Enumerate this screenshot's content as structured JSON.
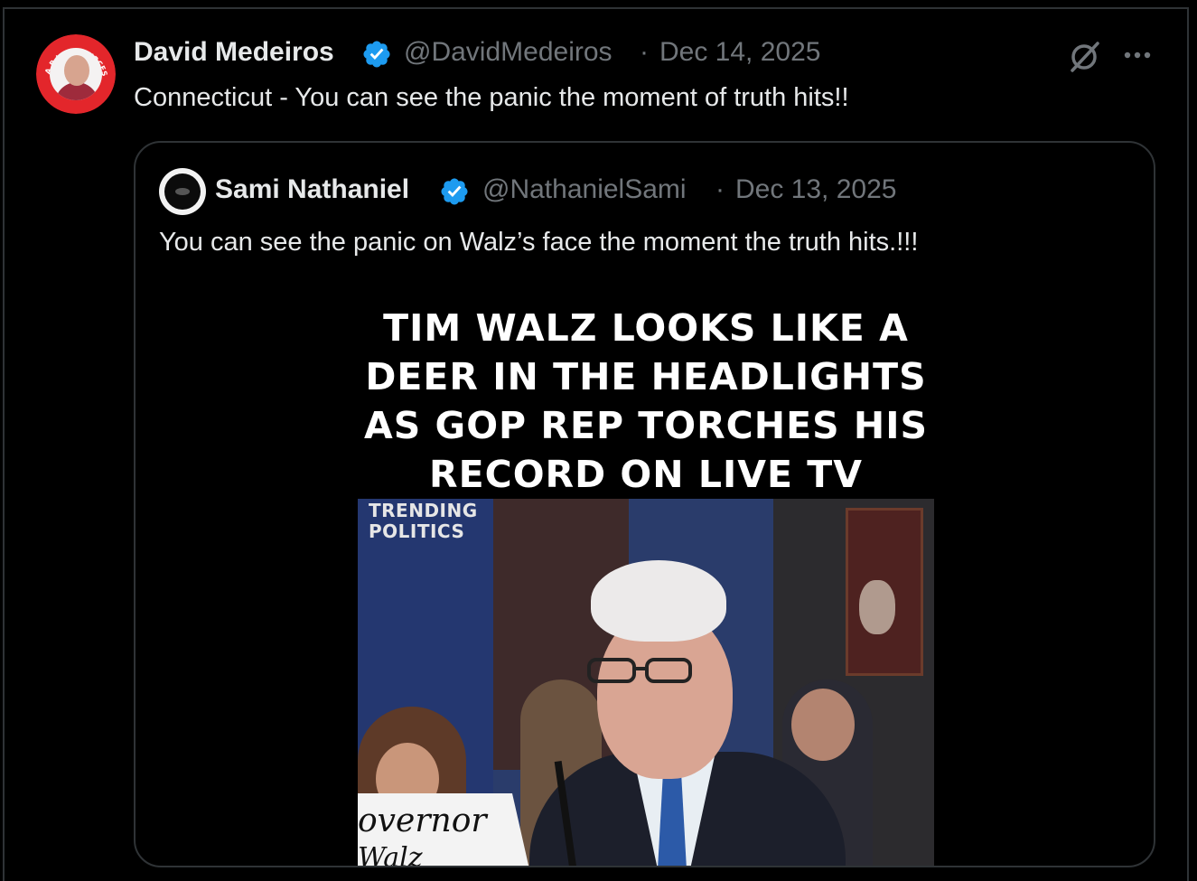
{
  "post": {
    "author_name": "David Medeiros",
    "author_handle": "@DavidMedeiros",
    "separator": "·",
    "date": "Dec 14, 2025",
    "text": "Connecticut - You can see the panic the moment of truth hits!!",
    "avatar_ring_text": "A.B.I. RESOURCES"
  },
  "quote": {
    "author_name": "Sami Nathaniel",
    "author_handle": "@NathanielSami",
    "separator": "·",
    "date": "Dec 13, 2025",
    "text": "You can see the panic on Walz’s face the moment the truth hits.!!!",
    "media": {
      "headline_lines": [
        "TIM WALZ LOOKS LIKE A",
        "DEER IN THE HEADLIGHTS",
        "AS GOP REP TORCHES HIS",
        "RECORD ON LIVE TV"
      ],
      "logo_line1": "TRENDING",
      "logo_line2": "POLITICS",
      "nameplate_line1": "overnor",
      "nameplate_line2": "Walz"
    }
  },
  "icons": {
    "grok": "grok-slash-icon",
    "more": "more-horizontal-icon",
    "verified": "verified-badge-icon"
  },
  "colors": {
    "background": "#000000",
    "text_primary": "#e7e9ea",
    "text_secondary": "#71767b",
    "border": "#2f3336",
    "verified_blue": "#1d9bf0"
  }
}
